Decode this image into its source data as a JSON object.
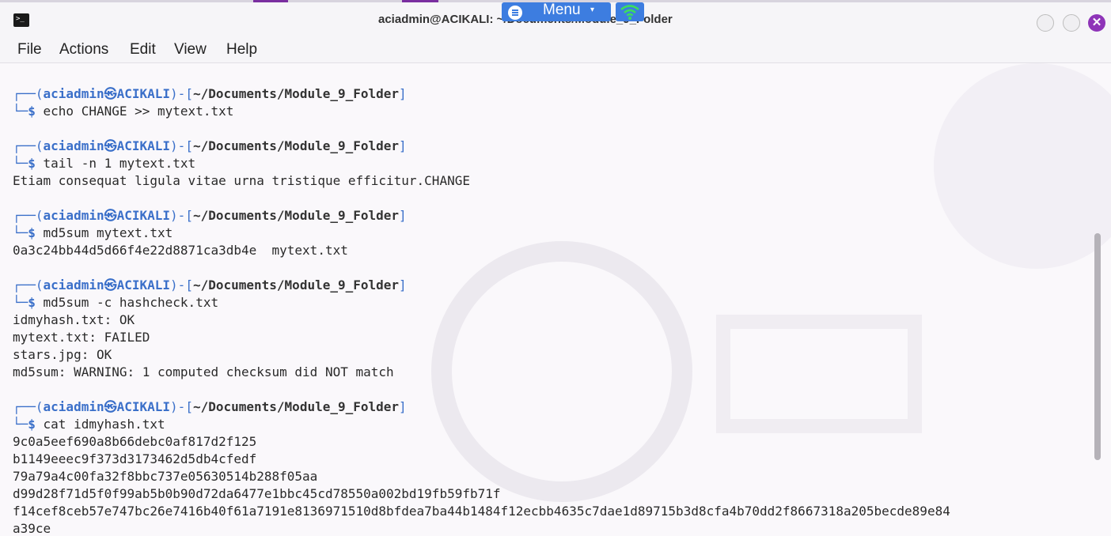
{
  "window": {
    "title": "aciadmin@ACIKALI: ~/Documents/Module_9_Folder"
  },
  "overlay": {
    "menu_label": "Menu",
    "menu_caret": "▾"
  },
  "menubar": {
    "items": [
      "File",
      "Actions",
      "Edit",
      "View",
      "Help"
    ]
  },
  "prompt": {
    "user": "aciadmin",
    "at_symbol": "㉿",
    "host": "ACIKALI",
    "path": "~/Documents/Module_9_Folder"
  },
  "blocks": [
    {
      "command": "echo CHANGE >> mytext.txt",
      "output": []
    },
    {
      "command": "tail -n 1 mytext.txt",
      "output": [
        "Etiam consequat ligula vitae urna tristique efficitur.CHANGE"
      ]
    },
    {
      "command": "md5sum mytext.txt",
      "output": [
        "0a3c24bb44d5d66f4e22d8871ca3db4e  mytext.txt"
      ]
    },
    {
      "command": "md5sum -c hashcheck.txt",
      "output": [
        "idmyhash.txt: OK",
        "mytext.txt: FAILED",
        "stars.jpg: OK",
        "md5sum: WARNING: 1 computed checksum did NOT match"
      ]
    },
    {
      "command": "cat idmyhash.txt",
      "output": [
        "9c0a5eef690a8b66debc0af817d2f125",
        "b1149eeec9f373d3173462d5db4cfedf",
        "79a79a4c00fa32f8bbc737e05630514b288f05aa",
        "d99d28f71d5f0f99ab5b0b90d72da6477e1bbc45cd78550a002bd19fb59fb71f",
        "f14cef8ceb57e747bc26e7416b40f61a7191e8136971510d8bfdea7ba44b1484f12ecbb4635c7dae1d89715b3d8cfa4b70dd2f8667318a205becde89e84",
        "a39ce"
      ]
    }
  ],
  "colors": {
    "prompt_blue": "#3a6fc9",
    "close_button": "#8e34b8",
    "overlay_blue": "#3d7de0"
  }
}
